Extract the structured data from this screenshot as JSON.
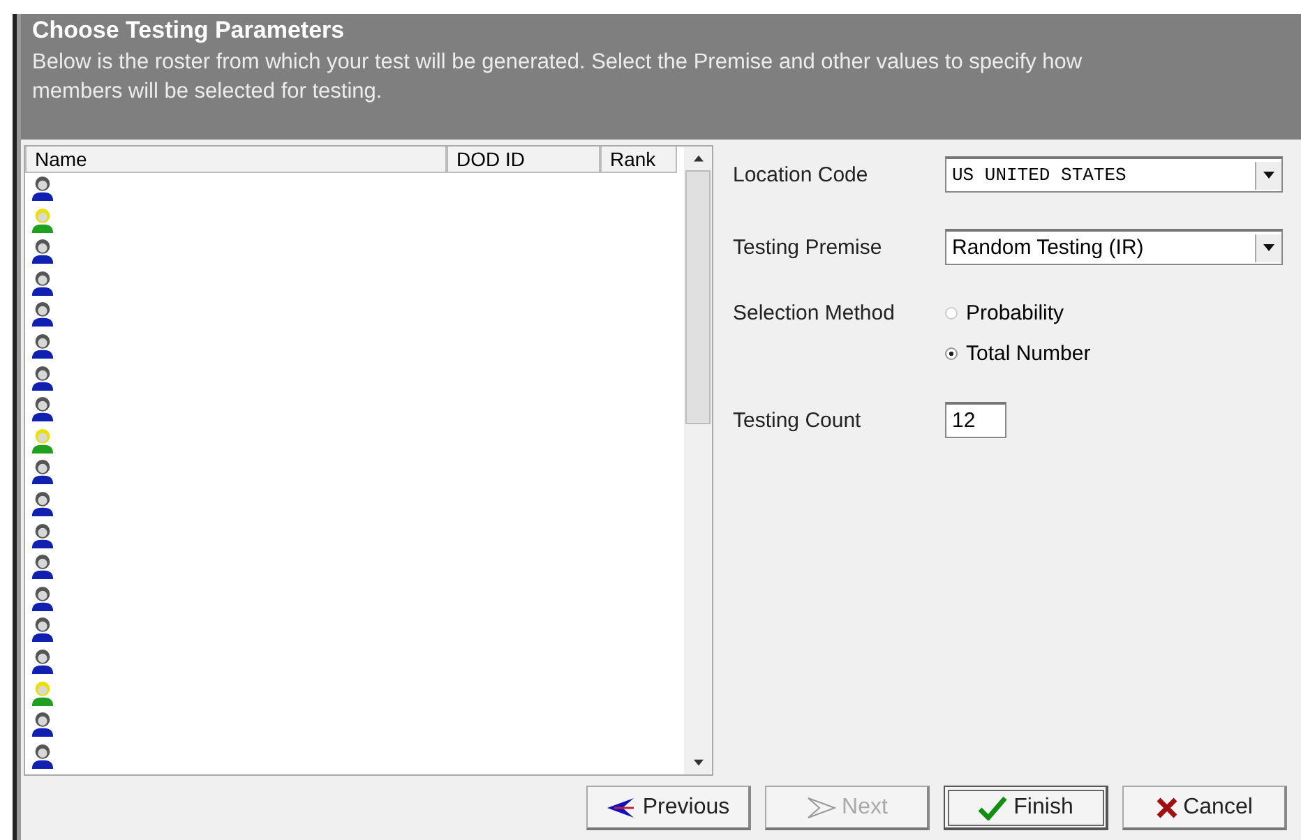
{
  "header": {
    "title": "Choose Testing Parameters",
    "description": "Below is the roster from which your test will be generated.  Select the Premise and other values to specify how members will be selected for testing."
  },
  "roster": {
    "columns": [
      "Name",
      "DOD ID",
      "Rank"
    ],
    "rows": [
      {
        "kind": "male"
      },
      {
        "kind": "female"
      },
      {
        "kind": "male"
      },
      {
        "kind": "male"
      },
      {
        "kind": "male"
      },
      {
        "kind": "male"
      },
      {
        "kind": "male"
      },
      {
        "kind": "male"
      },
      {
        "kind": "female"
      },
      {
        "kind": "male"
      },
      {
        "kind": "male"
      },
      {
        "kind": "male"
      },
      {
        "kind": "male"
      },
      {
        "kind": "male"
      },
      {
        "kind": "male"
      },
      {
        "kind": "male"
      },
      {
        "kind": "female"
      },
      {
        "kind": "male"
      },
      {
        "kind": "male"
      }
    ]
  },
  "form": {
    "location_code": {
      "label": "Location Code",
      "value": "US UNITED STATES"
    },
    "testing_premise": {
      "label": "Testing Premise",
      "value": "Random Testing (IR)"
    },
    "selection_method": {
      "label": "Selection Method",
      "options": [
        {
          "label": "Probability",
          "selected": false
        },
        {
          "label": "Total Number",
          "selected": true
        }
      ]
    },
    "testing_count": {
      "label": "Testing Count",
      "value": "12"
    }
  },
  "buttons": [
    {
      "kind": "previous",
      "label": "Previous",
      "disabled": false
    },
    {
      "kind": "next",
      "label": "Next",
      "disabled": true
    },
    {
      "kind": "finish",
      "label": "Finish",
      "disabled": false
    },
    {
      "kind": "cancel",
      "label": "Cancel",
      "disabled": false
    }
  ]
}
